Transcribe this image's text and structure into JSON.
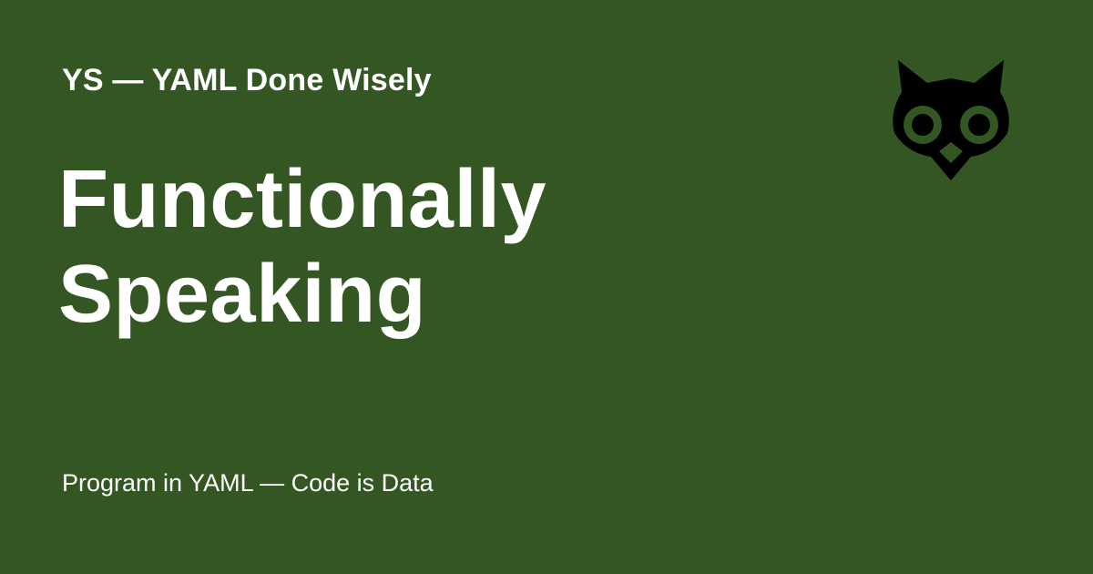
{
  "colors": {
    "background": "#335623",
    "text": "#ffffff",
    "logo": "#000000"
  },
  "header": {
    "site_name": "YS — YAML Done Wisely"
  },
  "main": {
    "title_lines": [
      "Functionally",
      "Speaking"
    ]
  },
  "footer": {
    "tagline": "Program in YAML — Code is Data"
  },
  "logo": {
    "icon": "owl-icon"
  }
}
